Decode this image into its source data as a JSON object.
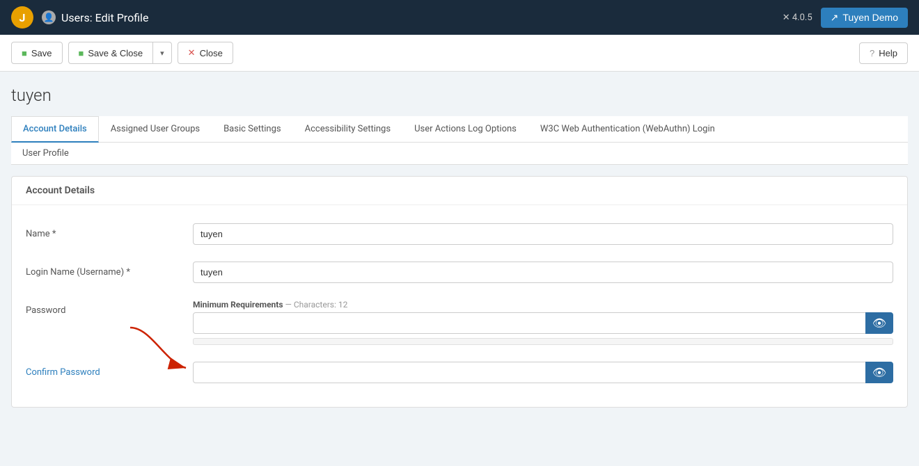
{
  "app": {
    "logo": "J",
    "version": "4.0.5",
    "page_title": "Users: Edit Profile"
  },
  "user_button": {
    "icon": "↗",
    "label": "Tuyen Demo"
  },
  "toolbar": {
    "save_label": "Save",
    "save_close_label": "Save & Close",
    "close_label": "Close",
    "help_label": "Help",
    "dropdown_icon": "▾"
  },
  "username_heading": "tuyen",
  "tabs": [
    {
      "id": "account-details",
      "label": "Account Details",
      "active": true
    },
    {
      "id": "assigned-user-groups",
      "label": "Assigned User Groups",
      "active": false
    },
    {
      "id": "basic-settings",
      "label": "Basic Settings",
      "active": false
    },
    {
      "id": "accessibility-settings",
      "label": "Accessibility Settings",
      "active": false
    },
    {
      "id": "user-actions-log",
      "label": "User Actions Log Options",
      "active": false
    },
    {
      "id": "w3c-webauthn",
      "label": "W3C Web Authentication (WebAuthn) Login",
      "active": false
    }
  ],
  "secondary_tabs": [
    {
      "id": "user-profile",
      "label": "User Profile"
    }
  ],
  "form": {
    "section_title": "Account Details",
    "fields": {
      "name": {
        "label": "Name *",
        "value": "tuyen",
        "placeholder": ""
      },
      "login_name": {
        "label": "Login Name (Username) *",
        "value": "tuyen",
        "placeholder": ""
      },
      "password": {
        "label": "Password",
        "value": "",
        "placeholder": "",
        "hint_label": "Minimum Requirements",
        "hint_dash": "—",
        "hint_chars": "Characters: 12"
      },
      "confirm_password": {
        "label": "Confirm Password",
        "value": "",
        "placeholder": ""
      }
    }
  },
  "icons": {
    "user": "👤",
    "save": "💾",
    "question": "?",
    "eye": "👁",
    "x": "✕",
    "check": "✓",
    "chevron_down": "▾"
  },
  "colors": {
    "header_bg": "#1a2b3c",
    "accent": "#2d7fbd",
    "save_green": "#5cb85c",
    "close_red": "#d9534f",
    "btn_eye_bg": "#2d6da3"
  }
}
